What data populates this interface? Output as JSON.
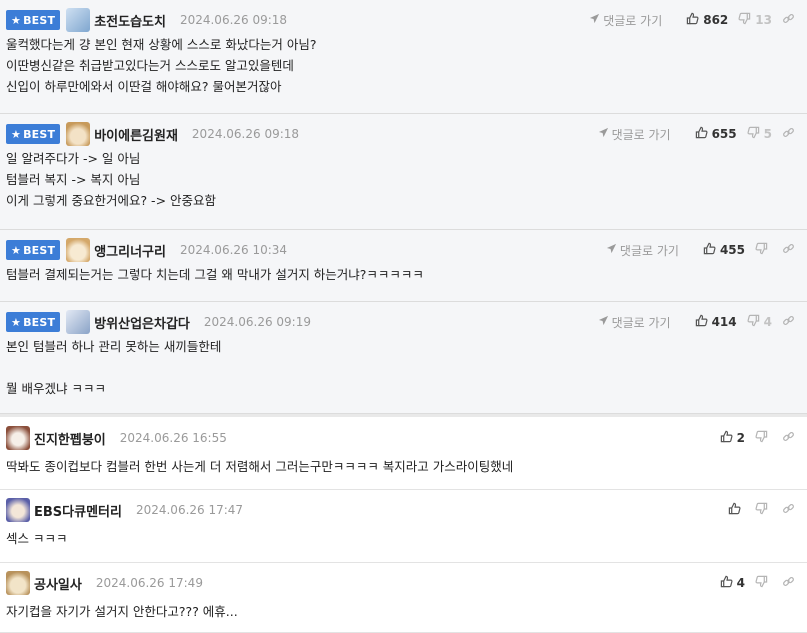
{
  "best_label": "BEST",
  "reply_label": "댓글로 가기",
  "comments": [
    {
      "best": true,
      "nickname": "초전도습도치",
      "date": "2024.06.26 09:18",
      "likes": "862",
      "dislikes": "13",
      "lines": [
        "울컥했다는게 걍 본인 현재 상황에 스스로 화났다는거 아님?",
        "이딴병신같은 취급받고있다는거 스스로도 알고있을텐데",
        "신입이 하루만에와서 이딴걸 해야해요? 물어본거잖아"
      ]
    },
    {
      "best": true,
      "nickname": "바이에른김원재",
      "date": "2024.06.26 09:18",
      "likes": "655",
      "dislikes": "5",
      "lines": [
        "일 알려주다가 -> 일 아님",
        "텀블러 복지 -> 복지 아님",
        "이게 그렇게 중요한거에요? -> 안중요함"
      ]
    },
    {
      "best": true,
      "nickname": "앵그리너구리",
      "date": "2024.06.26 10:34",
      "likes": "455",
      "dislikes": "",
      "lines": [
        "텀블러 결제되는거는 그렇다 치는데 그걸 왜 막내가 설거지 하는거냐?ㅋㅋㅋㅋㅋ"
      ]
    },
    {
      "best": true,
      "nickname": "방위산업은차갑다",
      "date": "2024.06.26 09:19",
      "likes": "414",
      "dislikes": "4",
      "lines": [
        "본인 텀블러 하나 관리 못하는 새끼들한테",
        "",
        "뭘 배우겠냐 ㅋㅋㅋ"
      ]
    },
    {
      "best": false,
      "nickname": "진지한펩붕이",
      "date": "2024.06.26 16:55",
      "likes": "2",
      "dislikes": "",
      "lines": [
        "딱봐도 종이컵보다 컴블러 한번 사는게 더 저렴해서 그러는구만ㅋㅋㅋㅋ 복지라고 가스라이팅했네"
      ]
    },
    {
      "best": false,
      "nickname": "EBS다큐멘터리",
      "date": "2024.06.26 17:47",
      "likes": "",
      "dislikes": "",
      "lines": [
        "섹스 ㅋㅋㅋ"
      ]
    },
    {
      "best": false,
      "nickname": "공사일사",
      "date": "2024.06.26 17:49",
      "likes": "4",
      "dislikes": "",
      "lines": [
        "자기컵을 자기가 설거지 안한다고??? 에휴..."
      ]
    }
  ],
  "colors": {
    "best_badge": "#3c7dd7",
    "best_bg": "#f5f6f8",
    "muted": "#9a9a9a"
  },
  "icons": [
    "star-icon",
    "reply-arrow-icon",
    "thumbs-up-icon",
    "thumbs-down-icon",
    "link-icon"
  ]
}
